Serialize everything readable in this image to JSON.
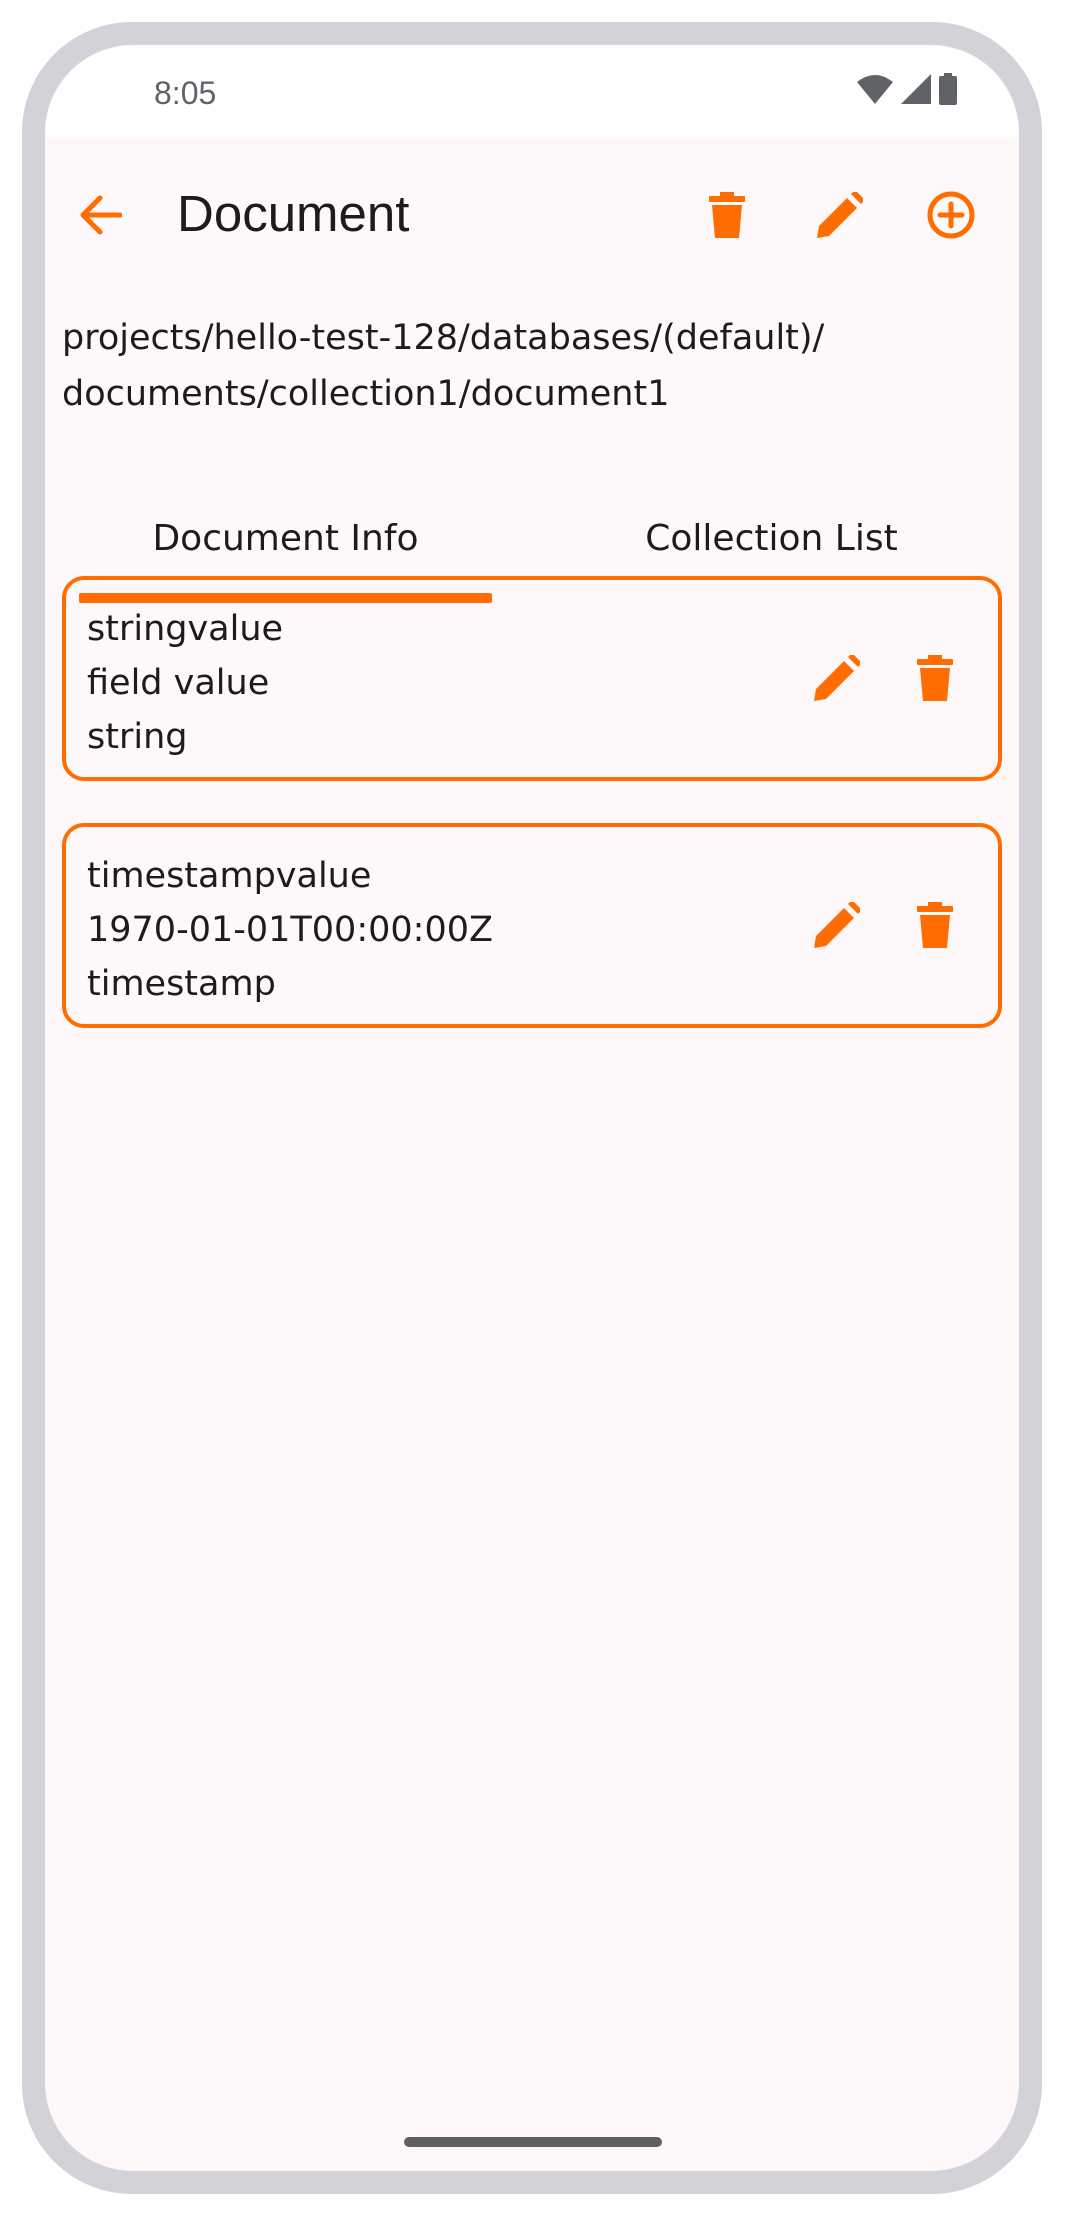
{
  "status_bar": {
    "time": "8:05"
  },
  "app_bar": {
    "title": "Document",
    "back_icon": "arrow-back-icon",
    "actions": [
      "delete-icon",
      "edit-icon",
      "add-circle-icon"
    ]
  },
  "document_path": "projects/hello-test-128/databases/(default)/\ndocuments/collection1/document1",
  "tabs": [
    {
      "label": "Document Info",
      "selected": true
    },
    {
      "label": "Collection List",
      "selected": false
    }
  ],
  "fields": [
    {
      "name": "stringvalue",
      "value": "field value",
      "type": "string"
    },
    {
      "name": "timestampvalue",
      "value": "1970-01-01T00:00:00Z",
      "type": "timestamp"
    }
  ],
  "colors": {
    "accent": "#ff6d00",
    "background": "#fef8fb",
    "text": "#1d1b1e"
  }
}
